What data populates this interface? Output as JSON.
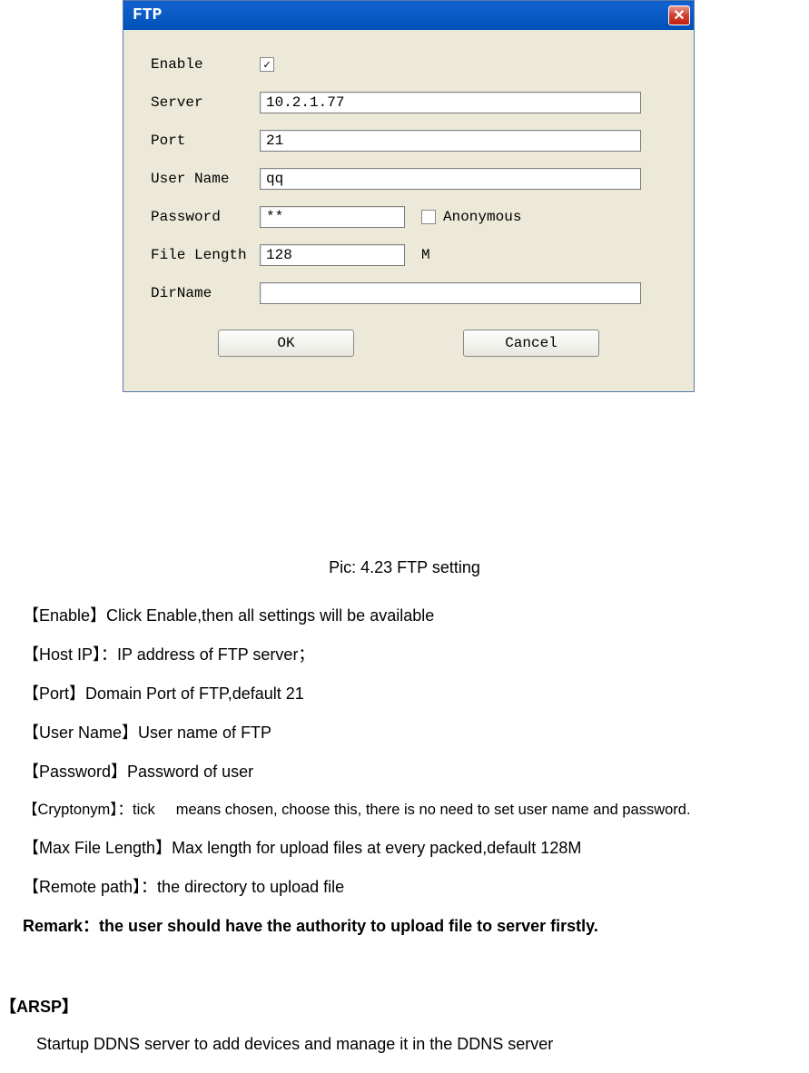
{
  "dialog": {
    "title": "FTP",
    "labels": {
      "enable": "Enable",
      "server": "Server",
      "port": "Port",
      "username": "User Name",
      "password": "Password",
      "anonymous": "Anonymous",
      "filelength": "File Length",
      "filelength_unit": "M",
      "dirname": "DirName"
    },
    "values": {
      "enable_checked": true,
      "server": "10.2.1.77",
      "port": "21",
      "username": "qq",
      "password": "**",
      "anonymous_checked": false,
      "filelength": "128",
      "dirname": ""
    },
    "buttons": {
      "ok": "OK",
      "cancel": "Cancel"
    }
  },
  "caption": "Pic: 4.23 FTP setting",
  "descriptions": {
    "enable": "【Enable】Click Enable,then all settings will be available",
    "hostip": "【Host IP】：IP address of FTP server；",
    "port": "【Port】Domain Port of FTP,default 21",
    "username": "【User Name】User name of FTP",
    "password": "【Password】Password of user",
    "cryptonym_pre": "【Cryptonym】：tick",
    "cryptonym_post": "means chosen, choose this, there is no need to set user name and password.",
    "maxfile": "【Max File Length】Max length for upload files at every packed,default 128M",
    "remotepath": "【Remote path】：the directory to upload file",
    "remark_pre": "Remark：the user ",
    "remark_mid": "should",
    "remark_post": " have the authority to upload file to server firstly."
  },
  "arsp": {
    "heading": "【ARSP】",
    "text": "Startup DDNS server to add devices and manage it in the DDNS server"
  }
}
